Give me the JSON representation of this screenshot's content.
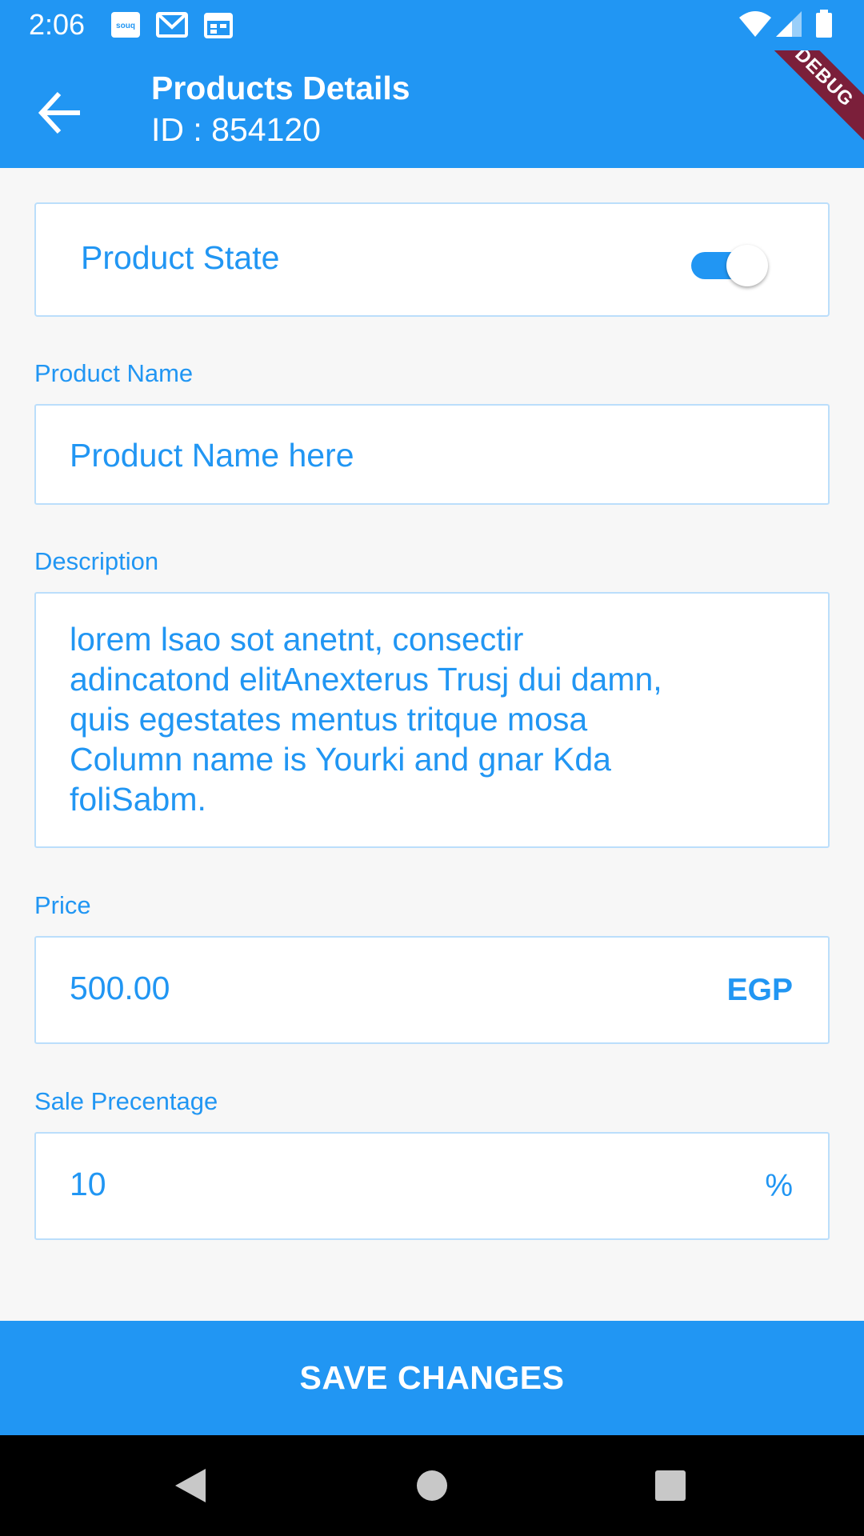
{
  "status_bar": {
    "time": "2:06",
    "notification_icons": [
      "souq-app-icon",
      "gmail-icon",
      "calendar-icon"
    ],
    "system_icons": [
      "wifi-icon",
      "signal-icon",
      "battery-icon"
    ]
  },
  "app_bar": {
    "title": "Products Details",
    "subtitle": "ID : 854120",
    "debug_banner": "DEBUG"
  },
  "product_state": {
    "label": "Product State",
    "enabled": true
  },
  "product_name": {
    "label": "Product Name",
    "value": "Product Name here"
  },
  "description": {
    "label": "Description",
    "value": "lorem lsao sot anetnt, consectir\nadincatond elitAnexterus Trusj dui damn,\nquis egestates mentus tritque mosa\nColumn name is Yourki and gnar Kda\nfoliSabm."
  },
  "price": {
    "label": "Price",
    "value": "500.00",
    "currency": "EGP"
  },
  "sale": {
    "label": "Sale Precentage",
    "value": "10",
    "unit": "%"
  },
  "save_button": {
    "label": "SAVE CHANGES"
  },
  "colors": {
    "primary": "#2196f3",
    "border": "#bbdefb",
    "background": "#f7f7f7"
  }
}
